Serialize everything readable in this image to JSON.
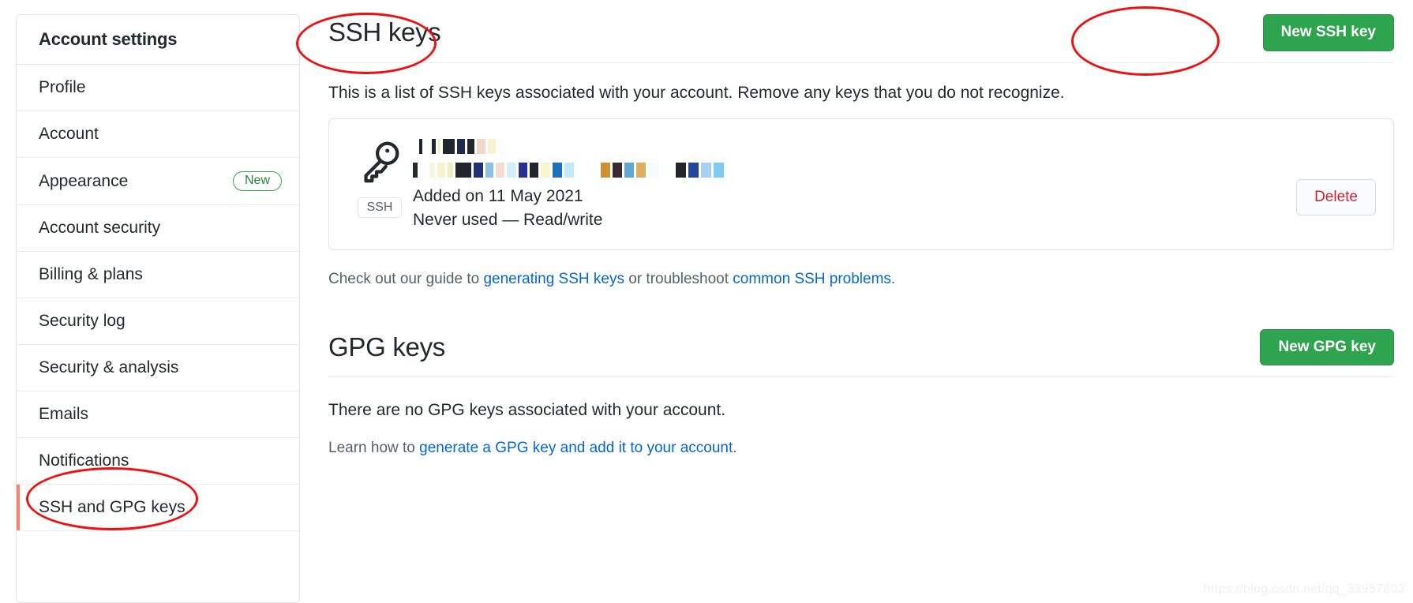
{
  "sidebar": {
    "heading": "Account settings",
    "items": [
      {
        "label": "Profile",
        "badge": "",
        "active": false
      },
      {
        "label": "Account",
        "badge": "",
        "active": false
      },
      {
        "label": "Appearance",
        "badge": "New",
        "active": false
      },
      {
        "label": "Account security",
        "badge": "",
        "active": false
      },
      {
        "label": "Billing & plans",
        "badge": "",
        "active": false
      },
      {
        "label": "Security log",
        "badge": "",
        "active": false
      },
      {
        "label": "Security & analysis",
        "badge": "",
        "active": false
      },
      {
        "label": "Emails",
        "badge": "",
        "active": false
      },
      {
        "label": "Notifications",
        "badge": "",
        "active": false
      },
      {
        "label": "SSH and GPG keys",
        "badge": "",
        "active": true
      }
    ]
  },
  "ssh_section": {
    "title": "SSH keys",
    "new_key_button": "New SSH key",
    "description": "This is a list of SSH keys associated with your account. Remove any keys that you do not recognize.",
    "key": {
      "icon_name": "key-icon",
      "type_badge": "SSH",
      "title_redacted": true,
      "fingerprint_redacted": true,
      "added": "Added on 11 May 2021",
      "usage": "Never used — Read/write",
      "delete_button": "Delete"
    },
    "guide": {
      "prefix": "Check out our guide to ",
      "link1": "generating SSH keys",
      "middle": " or troubleshoot ",
      "link2": "common SSH problems",
      "suffix": "."
    }
  },
  "gpg_section": {
    "title": "GPG keys",
    "new_key_button": "New GPG key",
    "empty_message": "There are no GPG keys associated with your account.",
    "learn": {
      "prefix": "Learn how to ",
      "link": "generate a GPG key and add it to your account",
      "suffix": "."
    }
  },
  "watermark": "https://blog.csdn.net/qq_33957603",
  "colors": {
    "green_button": "#2ea44f",
    "delete_text": "#cb2431",
    "link": "#0366d6",
    "active_indicator": "#f9826c",
    "annotation": "#ee1111",
    "new_badge": "#22863a"
  },
  "redaction": {
    "line1": [
      {
        "w": 5,
        "c": "#ffffff"
      },
      {
        "w": 4,
        "c": "#1a2430"
      },
      {
        "w": 6,
        "c": "#ffffff"
      },
      {
        "w": 5,
        "c": "#1c2532"
      },
      {
        "w": 3,
        "c": "#f5f0c8"
      },
      {
        "w": 15,
        "c": "#20262e"
      },
      {
        "w": 10,
        "c": "#1e2b4f"
      },
      {
        "w": 9,
        "c": "#22272f"
      },
      {
        "w": 11,
        "c": "#f2d6cc"
      },
      {
        "w": 10,
        "c": "#f6f3d2"
      },
      {
        "w": 8,
        "c": "#fbfbfb"
      }
    ],
    "line2": [
      {
        "w": 6,
        "c": "#24292e"
      },
      {
        "w": 9,
        "c": "#fdfbfb"
      },
      {
        "w": 7,
        "c": "#f7f6e3"
      },
      {
        "w": 10,
        "c": "#f7f4cf"
      },
      {
        "w": 7,
        "c": "#eef0bc"
      },
      {
        "w": 20,
        "c": "#22262c"
      },
      {
        "w": 12,
        "c": "#232f74"
      },
      {
        "w": 10,
        "c": "#8cc0e0"
      },
      {
        "w": 11,
        "c": "#f7ddd0"
      },
      {
        "w": 12,
        "c": "#d6f0fb"
      },
      {
        "w": 11,
        "c": "#2a2f96"
      },
      {
        "w": 11,
        "c": "#22262c"
      },
      {
        "w": 12,
        "c": "#f9f6cf"
      },
      {
        "w": 12,
        "c": "#1f6fc0"
      },
      {
        "w": 12,
        "c": "#bfeaf9"
      },
      {
        "w": 28,
        "c": "#ffffff"
      },
      {
        "w": 12,
        "c": "#d1902f"
      },
      {
        "w": 12,
        "c": "#3a2a2e"
      },
      {
        "w": 12,
        "c": "#5fa8d3"
      },
      {
        "w": 12,
        "c": "#e0ac5e"
      },
      {
        "w": 13,
        "c": "#f4fbfd"
      },
      {
        "w": 16,
        "c": "#ffffff"
      },
      {
        "w": 13,
        "c": "#23272b"
      },
      {
        "w": 13,
        "c": "#24459b"
      },
      {
        "w": 13,
        "c": "#a9d1ef"
      },
      {
        "w": 13,
        "c": "#7fcbf5"
      }
    ]
  }
}
